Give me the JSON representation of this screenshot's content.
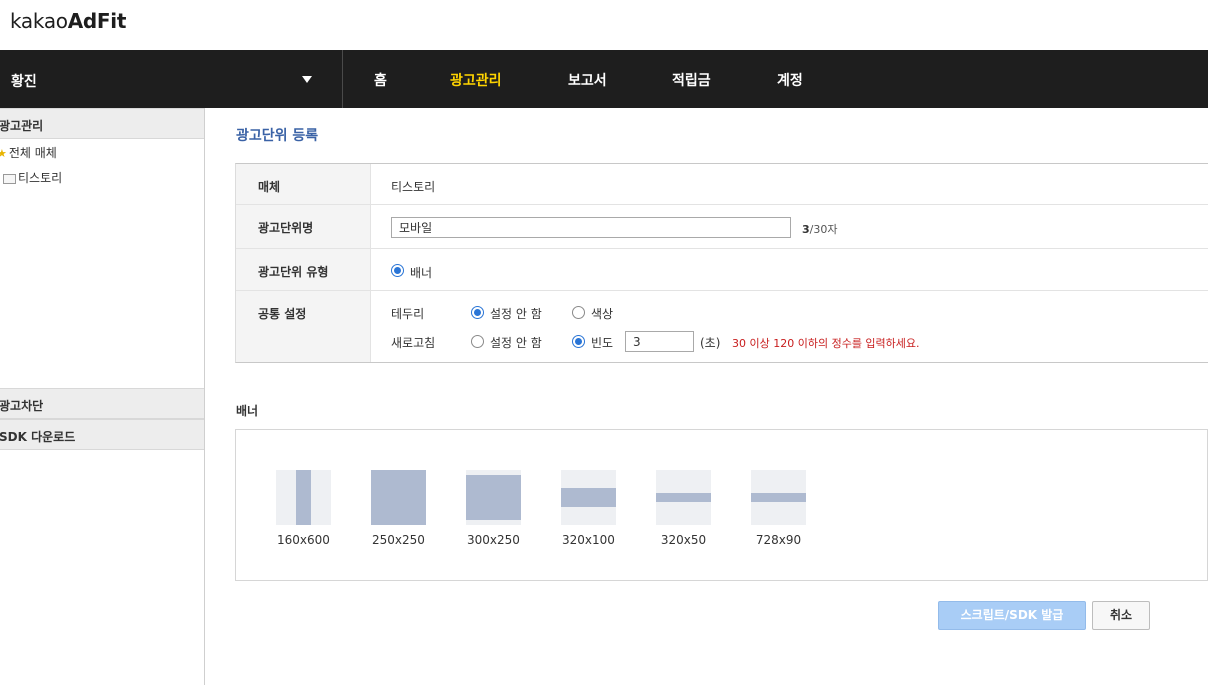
{
  "logo": {
    "prefix": "kakao",
    "bold": "AdFit"
  },
  "topnav": {
    "account_name": "황진",
    "menu": [
      "홈",
      "광고관리",
      "보고서",
      "적립금",
      "계정"
    ],
    "active_menu": "광고관리"
  },
  "sidebar": {
    "section_ad_manage": "광고관리",
    "tree_all": "전체 매체",
    "tree_media": "티스토리",
    "section_ad_block": "광고차단",
    "section_sdk": "SDK 다운로드"
  },
  "main": {
    "page_title": "광고단위 등록",
    "form": {
      "media_label": "매체",
      "media_value": "티스토리",
      "unit_name_label": "광고단위명",
      "unit_name_value": "모바일",
      "unit_name_count": "3",
      "unit_name_max": "/30자",
      "unit_type_label": "광고단위 유형",
      "unit_type_option": "배너",
      "common_label": "공통 설정",
      "border_label": "테두리",
      "border_opt_none": "설정 안 함",
      "border_opt_color": "색상",
      "border_selected": "설정 안 함",
      "refresh_label": "새로고침",
      "refresh_opt_none": "설정 안 함",
      "refresh_opt_freq": "빈도",
      "refresh_selected": "빈도",
      "refresh_value": "3",
      "refresh_unit": "(초)",
      "refresh_hint": "30 이상 120 이하의 정수를 입력하세요."
    },
    "banner_section_title": "배너",
    "banner_sizes": [
      "160x600",
      "250x250",
      "300x250",
      "320x100",
      "320x50",
      "728x90"
    ]
  },
  "buttons": {
    "issue": "스크립트/SDK 발급",
    "cancel": "취소"
  },
  "colors": {
    "nav_bg": "#1e1e1e",
    "nav_active": "#ffd400",
    "title_blue": "#3a62a6",
    "hint_red": "#c81e1e",
    "radio_blue": "#2a75d6",
    "banner_fill": "#aebad0"
  }
}
